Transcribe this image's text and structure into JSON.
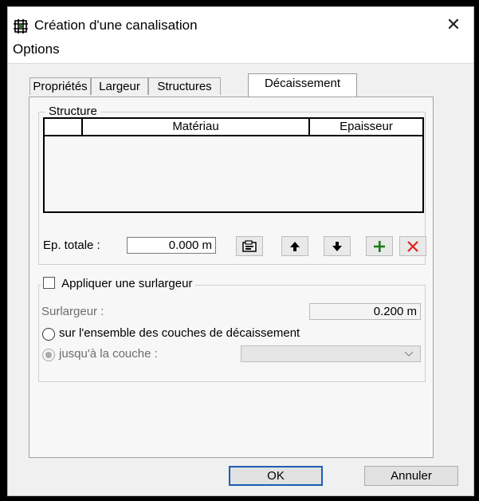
{
  "window": {
    "title": "Création d'une canalisation",
    "close_glyph": "✕"
  },
  "menu": {
    "options_label": "Options"
  },
  "tabs": [
    {
      "label": "Propriétés"
    },
    {
      "label": "Largeur"
    },
    {
      "label": "Structures"
    },
    {
      "label": "Décaissement",
      "active": true
    }
  ],
  "structure": {
    "group_label": "Structure",
    "columns": [
      "",
      "Matériau",
      "Epaisseur"
    ],
    "total_label": "Ep. totale :",
    "total_value": "0.000 m"
  },
  "surlargeur": {
    "checkbox_label": "Appliquer une surlargeur",
    "checked": false,
    "field_label": "Surlargeur :",
    "field_value": "0.200 m",
    "option_all_label": "sur l'ensemble des couches de décaissement",
    "option_layer_label": "jusqu'à la couche :",
    "layer_selected": ""
  },
  "buttons": {
    "ok_label": "OK",
    "cancel_label": "Annuler"
  },
  "colors": {
    "accent": "#1a5fb4",
    "delete_red": "#e02020",
    "add_green": "#1e7a1e"
  }
}
